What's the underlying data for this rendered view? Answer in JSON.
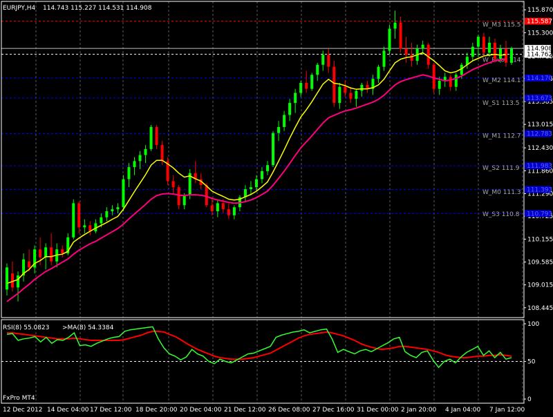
{
  "header": {
    "symbol": "EURJPY,H4",
    "ohlc": "114.743 115.227 114.531 114.908"
  },
  "indicator_header": {
    "rsi": "RSI(8) 55.0823",
    "ma": ">MA(8) 54.3384"
  },
  "watermark": "FxPro MT4",
  "colors": {
    "background": "#000000",
    "bull": "#00ff00",
    "bear": "#ff0000",
    "grid": "#5a5a5a",
    "pivot_line": "#0000ff",
    "ma_fast": "#ffff00",
    "ma_slow": "#ff0080",
    "rsi": "#33ff33",
    "rsi_ma": "#ff0000",
    "axis_text": "#ffffff",
    "pivot_label": "#a8a8a8"
  },
  "chart_data": [
    {
      "type": "candlestick",
      "ylim": [
        108.2,
        116.08
      ],
      "y_ticks": [
        "115.870",
        "115.300",
        "114.715",
        "114.155",
        "113.585",
        "113.015",
        "112.430",
        "111.860",
        "111.290",
        "110.725",
        "110.155",
        "109.585",
        "109.015",
        "108.445"
      ],
      "x_labels": [
        "12 Dec 2012",
        "14 Dec 04:00",
        "17 Dec 12:00",
        "18 Dec 20:00",
        "20 Dec 04:00",
        "21 Dec 12:00",
        "26 Dec 08:00",
        "27 Dec 16:00",
        "31 Dec 00:00",
        "2 Jan 20:00",
        "4 Jan 04:00",
        "7 Jan 12:00"
      ],
      "price_tags": [
        {
          "value": 115.587,
          "text": "115.587",
          "kind": "red"
        },
        {
          "value": 114.908,
          "text": "114.908",
          "kind": "white"
        },
        {
          "value": 114.762,
          "text": "114.762",
          "kind": "white"
        },
        {
          "value": 114.17,
          "text": "114.170",
          "kind": "blue"
        },
        {
          "value": 113.673,
          "text": "113.673",
          "kind": "blue"
        },
        {
          "value": 112.783,
          "text": "112.783",
          "kind": "blue"
        },
        {
          "value": 111.983,
          "text": "111.983",
          "kind": "blue"
        },
        {
          "value": 111.393,
          "text": "111.393",
          "kind": "blue"
        },
        {
          "value": 110.793,
          "text": "110.793",
          "kind": "blue"
        }
      ],
      "pivot_labels": [
        {
          "text": "W_M3 115.5",
          "value": 115.5
        },
        {
          "text": "W_Pivot 114",
          "value": 114.63
        },
        {
          "text": "W_M2 114.1",
          "value": 114.12
        },
        {
          "text": "W_S1 113.5",
          "value": 113.55
        },
        {
          "text": "W_M1 112.7",
          "value": 112.73
        },
        {
          "text": "W_S2 111.9",
          "value": 111.93
        },
        {
          "text": "W_M0 111.3",
          "value": 111.33
        },
        {
          "text": "W_S3 110.8",
          "value": 110.78
        }
      ],
      "pivot_levels": [
        115.587,
        114.762,
        114.17,
        113.673,
        112.783,
        111.983,
        111.393,
        110.793
      ],
      "current_price": 114.908,
      "candles": [
        [
          108.9,
          109.55,
          108.75,
          109.45
        ],
        [
          109.3,
          109.6,
          108.85,
          108.95
        ],
        [
          108.95,
          109.35,
          108.6,
          109.25
        ],
        [
          109.25,
          109.8,
          109.1,
          109.65
        ],
        [
          109.6,
          109.9,
          109.35,
          109.45
        ],
        [
          109.45,
          110.0,
          109.3,
          109.9
        ],
        [
          109.9,
          110.2,
          109.5,
          109.7
        ],
        [
          109.7,
          110.05,
          109.4,
          109.95
        ],
        [
          109.95,
          110.3,
          109.5,
          109.6
        ],
        [
          109.6,
          110.05,
          109.45,
          109.9
        ],
        [
          109.9,
          110.0,
          109.7,
          109.8
        ],
        [
          109.8,
          110.3,
          109.75,
          110.2
        ],
        [
          110.2,
          111.15,
          110.15,
          111.05
        ],
        [
          111.05,
          111.1,
          110.3,
          110.45
        ],
        [
          110.45,
          110.65,
          110.3,
          110.5
        ],
        [
          110.5,
          110.6,
          110.25,
          110.35
        ],
        [
          110.35,
          110.65,
          110.3,
          110.55
        ],
        [
          110.55,
          110.8,
          110.45,
          110.7
        ],
        [
          110.7,
          110.95,
          110.6,
          110.85
        ],
        [
          110.85,
          111.0,
          110.75,
          110.9
        ],
        [
          110.9,
          111.05,
          110.8,
          110.95
        ],
        [
          110.95,
          111.75,
          110.85,
          111.65
        ],
        [
          111.65,
          112.05,
          111.45,
          111.95
        ],
        [
          111.95,
          112.2,
          111.75,
          112.1
        ],
        [
          112.1,
          112.35,
          111.9,
          112.25
        ],
        [
          112.25,
          112.5,
          112.05,
          112.4
        ],
        [
          112.4,
          113.0,
          112.35,
          112.95
        ],
        [
          112.95,
          113.0,
          112.4,
          112.5
        ],
        [
          112.5,
          112.6,
          112.0,
          112.1
        ],
        [
          112.1,
          112.2,
          111.5,
          111.6
        ],
        [
          111.6,
          111.75,
          111.3,
          111.45
        ],
        [
          111.45,
          111.5,
          110.9,
          111.0
        ],
        [
          111.0,
          111.3,
          110.9,
          111.25
        ],
        [
          111.25,
          111.9,
          111.15,
          111.8
        ],
        [
          111.8,
          112.1,
          111.55,
          111.65
        ],
        [
          111.65,
          111.8,
          111.4,
          111.5
        ],
        [
          111.5,
          111.55,
          110.95,
          111.0
        ],
        [
          111.0,
          111.2,
          110.75,
          110.85
        ],
        [
          110.85,
          111.15,
          110.7,
          111.05
        ],
        [
          111.05,
          111.15,
          110.8,
          110.9
        ],
        [
          110.9,
          111.05,
          110.65,
          110.75
        ],
        [
          110.75,
          111.0,
          110.65,
          110.95
        ],
        [
          110.95,
          111.25,
          110.85,
          111.2
        ],
        [
          111.2,
          111.5,
          111.1,
          111.4
        ],
        [
          111.4,
          111.6,
          111.25,
          111.45
        ],
        [
          111.45,
          111.75,
          111.35,
          111.65
        ],
        [
          111.65,
          111.95,
          111.55,
          111.85
        ],
        [
          111.85,
          112.1,
          111.75,
          112.0
        ],
        [
          112.0,
          112.85,
          111.95,
          112.8
        ],
        [
          112.8,
          113.1,
          112.6,
          112.95
        ],
        [
          112.95,
          113.35,
          112.85,
          113.25
        ],
        [
          113.25,
          113.65,
          113.1,
          113.55
        ],
        [
          113.55,
          113.9,
          113.3,
          113.8
        ],
        [
          113.8,
          114.1,
          113.7,
          114.05
        ],
        [
          114.05,
          114.35,
          113.8,
          113.9
        ],
        [
          113.9,
          114.3,
          113.85,
          114.25
        ],
        [
          114.25,
          114.55,
          114.1,
          114.5
        ],
        [
          114.5,
          114.85,
          114.35,
          114.75
        ],
        [
          114.75,
          114.9,
          114.3,
          114.45
        ],
        [
          114.45,
          114.6,
          113.45,
          113.55
        ],
        [
          113.55,
          114.05,
          113.4,
          113.95
        ],
        [
          113.95,
          114.1,
          113.7,
          113.8
        ],
        [
          113.8,
          113.95,
          113.55,
          113.65
        ],
        [
          113.65,
          113.9,
          113.45,
          113.85
        ],
        [
          113.85,
          114.05,
          113.7,
          114.0
        ],
        [
          114.0,
          114.1,
          113.8,
          113.9
        ],
        [
          113.9,
          114.25,
          113.75,
          114.15
        ],
        [
          114.15,
          114.5,
          114.05,
          114.45
        ],
        [
          114.45,
          114.95,
          114.35,
          114.85
        ],
        [
          114.85,
          115.5,
          114.75,
          115.4
        ],
        [
          115.4,
          115.85,
          115.15,
          115.55
        ],
        [
          115.55,
          115.7,
          114.8,
          114.9
        ],
        [
          114.9,
          115.2,
          114.55,
          114.75
        ],
        [
          114.75,
          115.05,
          114.45,
          114.6
        ],
        [
          114.6,
          115.0,
          114.5,
          114.9
        ],
        [
          114.9,
          115.1,
          114.75,
          115.0
        ],
        [
          115.0,
          115.05,
          114.4,
          114.5
        ],
        [
          114.5,
          114.55,
          113.8,
          113.9
        ],
        [
          113.9,
          114.2,
          113.75,
          114.1
        ],
        [
          114.1,
          114.3,
          113.95,
          114.2
        ],
        [
          114.2,
          114.25,
          113.85,
          113.95
        ],
        [
          113.95,
          114.3,
          113.85,
          114.25
        ],
        [
          114.25,
          114.55,
          114.15,
          114.5
        ],
        [
          114.5,
          114.8,
          114.4,
          114.7
        ],
        [
          114.7,
          115.05,
          114.6,
          114.95
        ],
        [
          114.95,
          115.25,
          114.7,
          115.2
        ],
        [
          115.2,
          115.3,
          114.75,
          114.8
        ],
        [
          114.8,
          115.2,
          114.7,
          115.05
        ],
        [
          115.05,
          115.15,
          114.55,
          114.65
        ],
        [
          114.65,
          115.0,
          114.55,
          114.9
        ],
        [
          114.9,
          115.1,
          114.45,
          114.55
        ],
        [
          114.55,
          114.95,
          114.5,
          114.9
        ]
      ],
      "ma_fast": [
        109.05,
        109.1,
        109.15,
        109.3,
        109.4,
        109.55,
        109.62,
        109.72,
        109.72,
        109.76,
        109.78,
        109.85,
        110.08,
        110.18,
        110.27,
        110.35,
        110.43,
        110.5,
        110.57,
        110.65,
        110.72,
        110.9,
        111.12,
        111.34,
        111.55,
        111.76,
        112.0,
        112.12,
        112.12,
        112.03,
        111.93,
        111.8,
        111.7,
        111.73,
        111.66,
        111.6,
        111.48,
        111.35,
        111.28,
        111.22,
        111.15,
        111.13,
        111.15,
        111.21,
        111.27,
        111.35,
        111.46,
        111.58,
        111.83,
        112.1,
        112.38,
        112.67,
        112.94,
        113.2,
        113.38,
        113.58,
        113.8,
        114.02,
        114.14,
        114.04,
        114.02,
        113.98,
        113.92,
        113.89,
        113.9,
        113.9,
        113.93,
        114.0,
        114.14,
        114.35,
        114.55,
        114.64,
        114.68,
        114.7,
        114.75,
        114.8,
        114.7,
        114.6,
        114.48,
        114.35,
        114.3,
        114.33,
        114.4,
        114.5,
        114.6,
        114.66,
        114.72,
        114.74,
        114.76,
        114.74,
        114.75
      ],
      "ma_slow": [
        108.6,
        108.7,
        108.8,
        108.92,
        109.03,
        109.15,
        109.25,
        109.35,
        109.42,
        109.5,
        109.58,
        109.66,
        109.78,
        109.88,
        109.96,
        110.04,
        110.1,
        110.18,
        110.26,
        110.34,
        110.42,
        110.53,
        110.66,
        110.78,
        110.9,
        111.02,
        111.15,
        111.24,
        111.28,
        111.29,
        111.28,
        111.25,
        111.24,
        111.26,
        111.26,
        111.25,
        111.22,
        111.17,
        111.13,
        111.1,
        111.07,
        111.05,
        111.06,
        111.09,
        111.13,
        111.19,
        111.27,
        111.35,
        111.5,
        111.67,
        111.85,
        112.04,
        112.24,
        112.43,
        112.58,
        112.73,
        112.89,
        113.05,
        113.18,
        113.24,
        113.3,
        113.35,
        113.38,
        113.42,
        113.47,
        113.52,
        113.57,
        113.64,
        113.74,
        113.87,
        114.0,
        114.08,
        114.13,
        114.17,
        114.21,
        114.25,
        114.22,
        114.17,
        114.14,
        114.1,
        114.12,
        114.16,
        114.22,
        114.3,
        114.38,
        114.44,
        114.5,
        114.55,
        114.6,
        114.62,
        114.65
      ]
    },
    {
      "type": "line",
      "ylim": [
        0,
        100
      ],
      "y_ticks": [
        "100",
        "50",
        "0"
      ],
      "series": [
        {
          "name": "RSI(8)",
          "values": [
            86,
            87,
            78,
            80,
            81,
            83,
            76,
            82,
            74,
            79,
            78,
            82,
            88,
            71,
            72,
            70,
            74,
            77,
            80,
            82,
            83,
            90,
            92,
            93,
            94,
            95,
            96,
            80,
            68,
            60,
            57,
            52,
            56,
            66,
            60,
            57,
            50,
            47,
            53,
            50,
            48,
            52,
            56,
            60,
            61,
            64,
            67,
            70,
            82,
            85,
            87,
            89,
            90,
            92,
            88,
            90,
            92,
            93,
            80,
            62,
            66,
            63,
            60,
            64,
            66,
            63,
            67,
            71,
            75,
            80,
            82,
            63,
            58,
            55,
            62,
            64,
            52,
            42,
            50,
            53,
            48,
            56,
            62,
            66,
            70,
            58,
            64,
            55,
            62,
            53,
            55
          ]
        },
        {
          "name": ">MA(8)",
          "values": [
            88,
            88,
            87,
            86,
            85,
            84,
            83,
            82,
            81,
            80,
            80,
            80,
            81,
            80,
            79,
            78,
            78,
            78,
            78,
            78,
            78,
            79,
            81,
            83,
            85,
            88,
            90,
            90,
            89,
            86,
            83,
            79,
            74,
            70,
            66,
            63,
            60,
            57,
            55,
            54,
            53,
            53,
            53,
            54,
            55,
            57,
            59,
            61,
            65,
            69,
            73,
            77,
            81,
            84,
            86,
            87,
            88,
            89,
            88,
            86,
            84,
            81,
            78,
            74,
            71,
            69,
            67,
            66,
            67,
            68,
            70,
            70,
            69,
            68,
            67,
            66,
            64,
            62,
            59,
            57,
            56,
            55,
            55,
            56,
            57,
            57,
            58,
            58,
            59,
            58,
            57
          ]
        }
      ]
    }
  ]
}
